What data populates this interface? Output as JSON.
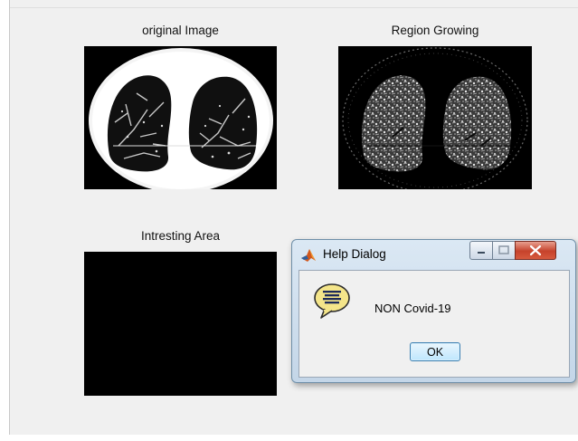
{
  "figure": {
    "panels": [
      {
        "title": "original Image"
      },
      {
        "title": "Region Growing"
      },
      {
        "title": "Intresting Area"
      }
    ]
  },
  "dialog": {
    "title": "Help Dialog",
    "message": "NON Covid-19",
    "ok_label": "OK",
    "app_icon": "matlab-icon",
    "help_icon": "help-speech-bubble-icon"
  },
  "colors": {
    "figure_background": "#f0f0f0",
    "close_button": "#c6422b",
    "ok_border": "#3c7fb1"
  }
}
